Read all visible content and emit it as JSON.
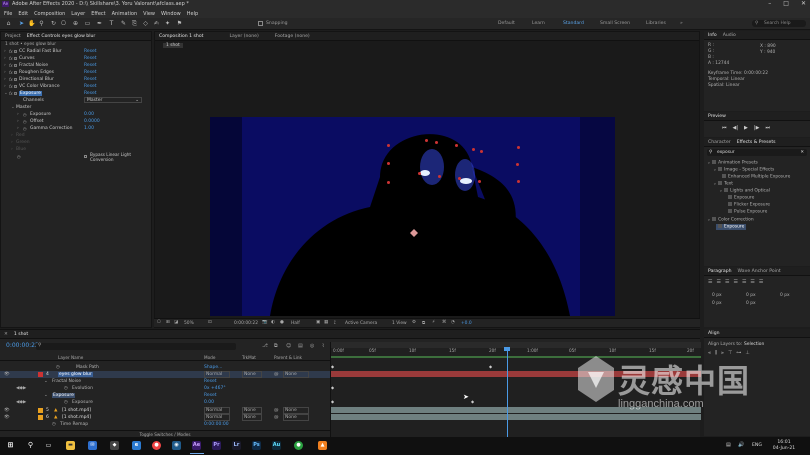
{
  "titlebar": {
    "title": "Adobe After Effects 2020 - D:\\\\ Skillshare\\3. Yoru Valorant\\afclass.aep *"
  },
  "menu": [
    "File",
    "Edit",
    "Composition",
    "Layer",
    "Effect",
    "Animation",
    "View",
    "Window",
    "Help"
  ],
  "toolbar": {
    "snapping": "Snapping",
    "workspaces": [
      "Default",
      "Learn",
      "Standard",
      "Small Screen",
      "Libraries"
    ],
    "active_ws": "Standard",
    "search_placeholder": "Search Help"
  },
  "project_panel": {
    "tabs": [
      "Project",
      "Effect Controls eyes glow blur"
    ],
    "breadcrumb": "1 shot • eyes glow blur",
    "effects": [
      {
        "name": "CC Radial Fast Blur",
        "reset": "Reset"
      },
      {
        "name": "Curves",
        "reset": "Reset"
      },
      {
        "name": "Fractal Noise",
        "reset": "Reset"
      },
      {
        "name": "Roughen Edges",
        "reset": "Reset"
      },
      {
        "name": "Directional Blur",
        "reset": "Reset"
      },
      {
        "name": "VC Color Vibrance",
        "reset": "Reset"
      },
      {
        "name": "Exposure",
        "reset": "Reset"
      }
    ],
    "channels_label": "Channels",
    "channels_value": "Master",
    "master_label": "Master",
    "props": [
      {
        "name": "Exposure",
        "value": "0.00"
      },
      {
        "name": "Offset",
        "value": "0.0000"
      },
      {
        "name": "Gamma Correction",
        "value": "1.00"
      }
    ],
    "dim_rows": [
      "Red",
      "Green",
      "Blue"
    ],
    "bypass_label": "Bypass Linear Light Conversion"
  },
  "comp_panel": {
    "tabs": [
      "Composition 1 shot",
      "Layer (none)",
      "Footage (none)"
    ],
    "comp_chip": "1 shot",
    "footer": {
      "zoom": "50%",
      "timecode": "0:00:00:22",
      "res": "Half",
      "camera": "Active Camera",
      "views": "1 View",
      "exposure": "+0.0"
    }
  },
  "timeline": {
    "comp": "1 shot",
    "timecode": "0:00:00:22",
    "columns": {
      "name": "Layer Name",
      "mode": "Mode",
      "trkmat": "TrkMat",
      "parent": "Parent & Link"
    },
    "rows": [
      {
        "label": "Mask Path",
        "type": "prop",
        "value": "Shape..."
      },
      {
        "num": "4",
        "label": "eyes glow blur",
        "type": "layer",
        "mode": "Normal",
        "trk": "None",
        "parent": "None",
        "color": "#c33"
      },
      {
        "label": "Fractal Noise",
        "type": "group",
        "value": "Reset"
      },
      {
        "label": "Evolution",
        "type": "prop",
        "value": "0x +467°"
      },
      {
        "label": "Exposure",
        "type": "group",
        "value": "Reset"
      },
      {
        "label": "Exposure",
        "type": "prop",
        "value": "0.00"
      },
      {
        "num": "5",
        "label": "[1 shot.mp4]",
        "type": "layer",
        "mode": "Normal",
        "trk": "None",
        "parent": "None",
        "color": "#e8a020"
      },
      {
        "num": "6",
        "label": "[1 shot.mp4]",
        "type": "layer",
        "mode": "Normal",
        "trk": "None",
        "parent": "None",
        "color": "#e8a020"
      },
      {
        "label": "Time Remap",
        "type": "prop",
        "value": "0:00:00:00"
      }
    ],
    "footer_label": "Toggle Switches / Modes",
    "ruler": [
      "0:00f",
      "05f",
      "10f",
      "15f",
      "20f",
      "1:00f",
      "05f",
      "10f",
      "15f",
      "20f"
    ]
  },
  "right_panels": {
    "info": {
      "tabs": [
        "Info",
        "Audio"
      ],
      "values": [
        "R : ",
        "G : ",
        "B : ",
        "A : 12744",
        "X : 890",
        "Y : 940"
      ],
      "keyframe": "Keyframe Time: 0:00:00:22",
      "temporal": "Temporal: Linear",
      "spatial": "Spatial: Linear"
    },
    "preview": {
      "title": "Preview"
    },
    "effects_presets": {
      "tabs": [
        "Character",
        "Effects & Presets"
      ],
      "query": "exposur",
      "tree": [
        "Animation Presets",
        "Image - Special Effects",
        "Enhanced Multiple Exposure",
        "Text",
        "Lights and Optical",
        "Exposure",
        "Flicker Exposure",
        "Pulse Exposure",
        "Color Correction",
        "Exposure"
      ]
    },
    "paragraph": {
      "tabs": [
        "Paragraph",
        "Wave Anchor Point"
      ],
      "values": [
        "0 px",
        "0 px",
        "0 px",
        "0 px",
        "0 px"
      ]
    },
    "align": {
      "title": "Align",
      "align_to_label": "Align Layers to:",
      "align_to": "Selection"
    }
  },
  "taskbar": {
    "time": "16:01",
    "date": "04-Jun-21",
    "lang": "ENG"
  },
  "watermark": {
    "cn": "灵感中国",
    "url": "lingganchina.com"
  }
}
